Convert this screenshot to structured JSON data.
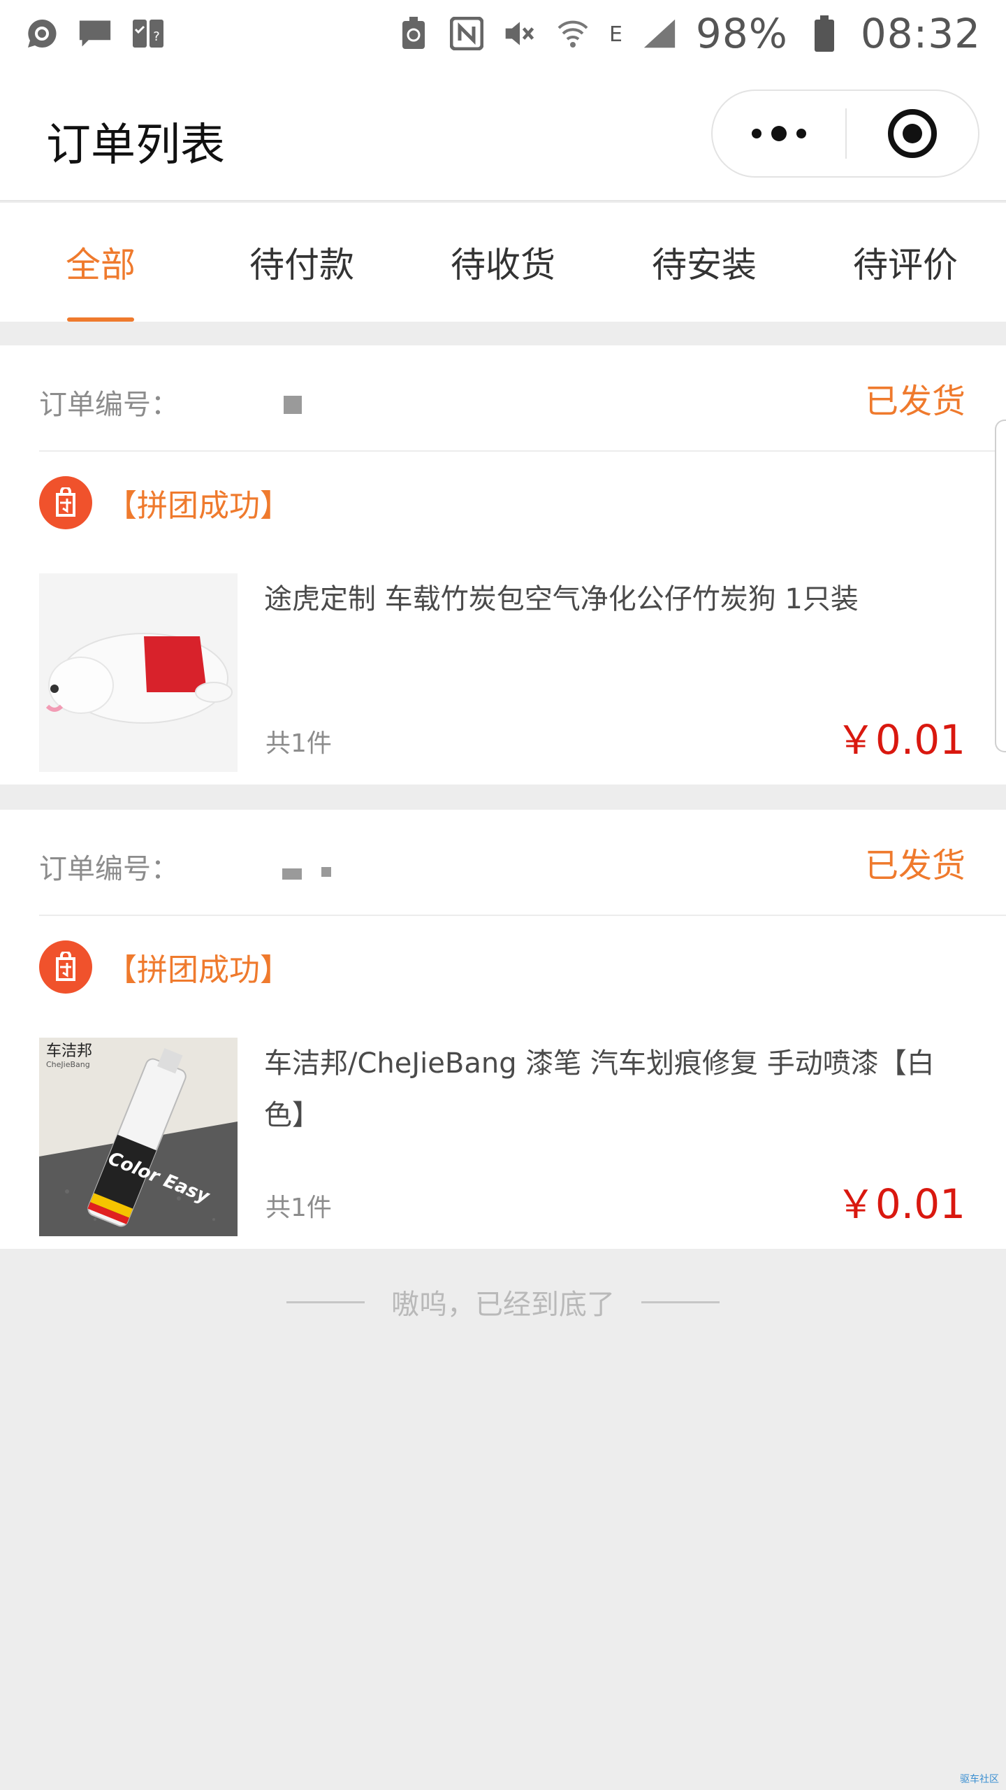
{
  "status_bar": {
    "left_icons": [
      "chat-bubble-icon",
      "message-icon",
      "task-check-icon"
    ],
    "right_icons": [
      "battery-saver-icon",
      "nfc-icon",
      "mute-icon",
      "wifi-icon",
      "signal-icon",
      "battery-icon"
    ],
    "network": "E",
    "battery": "98%",
    "time": "08:32"
  },
  "nav": {
    "title": "订单列表",
    "more_icon": "more-dots-icon",
    "close_icon": "target-close-icon"
  },
  "tabs": [
    {
      "label": "全部",
      "active": true
    },
    {
      "label": "待付款",
      "active": false
    },
    {
      "label": "待收货",
      "active": false
    },
    {
      "label": "待安装",
      "active": false
    },
    {
      "label": "待评价",
      "active": false
    }
  ],
  "orders": [
    {
      "order_no_label": "订单编号：",
      "status": "已发货",
      "group_label": "【拼团成功】",
      "group_icon": "group-buy-icon",
      "product_title": "途虎定制 车载竹炭包空气净化公仔竹炭狗 1只装",
      "quantity": "共1件",
      "currency": "￥",
      "price": "0.01",
      "image_icon": "bamboo-charcoal-dog-image"
    },
    {
      "order_no_label": "订单编号：",
      "status": "已发货",
      "group_label": "【拼团成功】",
      "group_icon": "group-buy-icon",
      "product_title": "车洁邦/CheJieBang 漆笔 汽车划痕修复 手动喷漆【白色】",
      "quantity": "共1件",
      "currency": "￥",
      "price": "0.01",
      "image_icon": "paint-pen-image",
      "image_text": {
        "brand": "车洁邦",
        "brand_en": "CheJieBang",
        "product": "Color Easy"
      }
    }
  ],
  "footer": {
    "end_text": "嗷呜，已经到底了"
  },
  "watermark": "驱车社区",
  "colors": {
    "accent": "#ef7a2d",
    "price": "#d9180f",
    "background": "#ededed",
    "badge": "#f0522c"
  }
}
